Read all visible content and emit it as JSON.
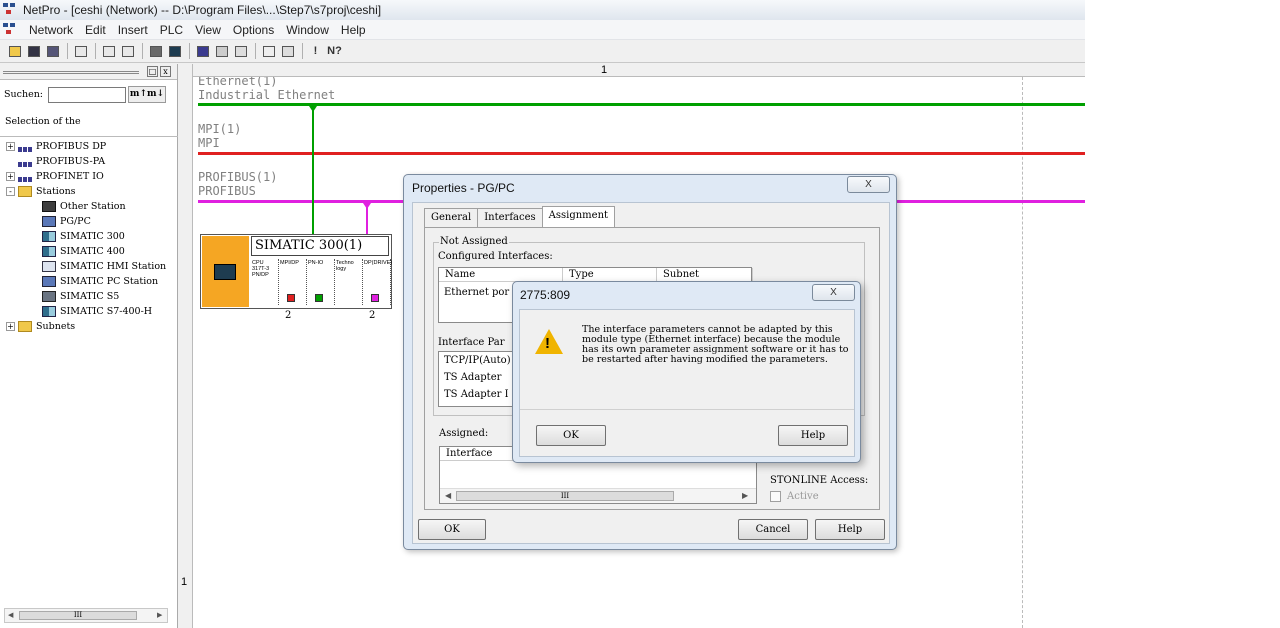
{
  "window": {
    "title": "NetPro - [ceshi (Network) -- D:\\Program Files\\...\\Step7\\s7proj\\ceshi]"
  },
  "menu": [
    "Network",
    "Edit",
    "Insert",
    "PLC",
    "View",
    "Options",
    "Window",
    "Help"
  ],
  "toolbar": [
    "open-icon",
    "save-icon",
    "download-icon",
    "print-icon",
    "copy-icon",
    "paste-icon",
    "station-icon",
    "hardware-icon",
    "network-icon",
    "tools-icon",
    "link-icon",
    "properties-icon",
    "monitor-icon",
    "!",
    "N?"
  ],
  "catalog": {
    "close_btn": "x",
    "restore_btn": "□",
    "search_label": "Suchen:",
    "search_value": "",
    "find_label": "m↑m↓",
    "selection_label": "Selection of the",
    "tree": [
      {
        "label": "PROFIBUS DP",
        "expander": "+",
        "icon": "net"
      },
      {
        "label": "PROFIBUS-PA",
        "expander": "",
        "icon": "net"
      },
      {
        "label": "PROFINET IO",
        "expander": "+",
        "icon": "net"
      },
      {
        "label": "Stations",
        "expander": "-",
        "icon": "folder"
      },
      {
        "label": "Other Station",
        "expander": "",
        "icon": "st",
        "indent": 1
      },
      {
        "label": "PG/PC",
        "expander": "",
        "icon": "pc",
        "indent": 1
      },
      {
        "label": "SIMATIC 300",
        "expander": "",
        "icon": "plc",
        "indent": 1
      },
      {
        "label": "SIMATIC 400",
        "expander": "",
        "icon": "plc",
        "indent": 1
      },
      {
        "label": "SIMATIC HMI Station",
        "expander": "",
        "icon": "hmi",
        "indent": 1
      },
      {
        "label": "SIMATIC PC Station",
        "expander": "",
        "icon": "pc",
        "indent": 1
      },
      {
        "label": "SIMATIC S5",
        "expander": "",
        "icon": "s5",
        "indent": 1
      },
      {
        "label": "SIMATIC S7-400-H",
        "expander": "",
        "icon": "plc",
        "indent": 1
      },
      {
        "label": "Subnets",
        "expander": "+",
        "icon": "folder"
      }
    ],
    "scroll_thumb": "III"
  },
  "ruler": {
    "top": "1",
    "left": "1"
  },
  "networks": [
    {
      "name": "Ethernet(1)",
      "type": "Industrial Ethernet",
      "color": "#00a000"
    },
    {
      "name": "MPI(1)",
      "type": "MPI",
      "color": "#e02020"
    },
    {
      "name": "PROFIBUS(1)",
      "type": "PROFIBUS",
      "color": "#e020e0"
    }
  ],
  "station": {
    "name": "SIMATIC 300(1)",
    "modules": [
      {
        "label": "CPU 317T-3 PN/DP",
        "led": ""
      },
      {
        "label": "MPI/DP",
        "led": "#e02020"
      },
      {
        "label": "PN-IO",
        "led": "#00a000"
      },
      {
        "label": "Techno logy",
        "led": ""
      },
      {
        "label": "DP(DRIVE)",
        "led": "#e020e0"
      }
    ],
    "port_a": "2",
    "port_b": "2"
  },
  "properties": {
    "title": "Properties - PG/PC",
    "tabs": [
      "General",
      "Interfaces",
      "Assignment"
    ],
    "not_assigned": "Not Assigned",
    "configured_interfaces": "Configured Interfaces:",
    "columns": [
      "Name",
      "Type",
      "Subnet"
    ],
    "rows": [
      "Ethernet por"
    ],
    "interface_params": "Interface Par",
    "param_items": [
      "TCP/IP(Auto)",
      "TS Adapter",
      "TS Adapter I"
    ],
    "assigned": "Assigned:",
    "assigned_col": "Interface",
    "scroll_thumb": "III",
    "stonline": "STONLINE Access:",
    "active": "Active",
    "ok": "OK",
    "cancel": "Cancel",
    "help": "Help",
    "close": "X"
  },
  "message": {
    "title": "2775:809",
    "text": "The interface parameters cannot be adapted by this module type (Ethernet interface) because the module has its own parameter assignment software or it has to be restarted after having modified the parameters.",
    "ok": "OK",
    "help": "Help",
    "close": "X",
    "icon": "warning-icon"
  }
}
